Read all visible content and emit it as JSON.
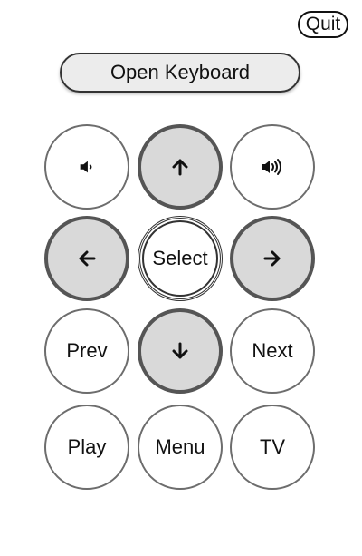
{
  "header": {
    "quit_label": "Quit"
  },
  "keyboard": {
    "open_label": "Open Keyboard"
  },
  "remote": {
    "volume_down_icon": "speaker-low-icon",
    "up_icon": "arrow-up-icon",
    "volume_up_icon": "speaker-high-icon",
    "left_icon": "arrow-left-icon",
    "select_label": "Select",
    "right_icon": "arrow-right-icon",
    "prev_label": "Prev",
    "down_icon": "arrow-down-icon",
    "next_label": "Next",
    "play_label": "Play",
    "menu_label": "Menu",
    "tv_label": "TV"
  },
  "colors": {
    "filled_button": "#d9d9d9",
    "border": "#555555",
    "background": "#ffffff"
  }
}
